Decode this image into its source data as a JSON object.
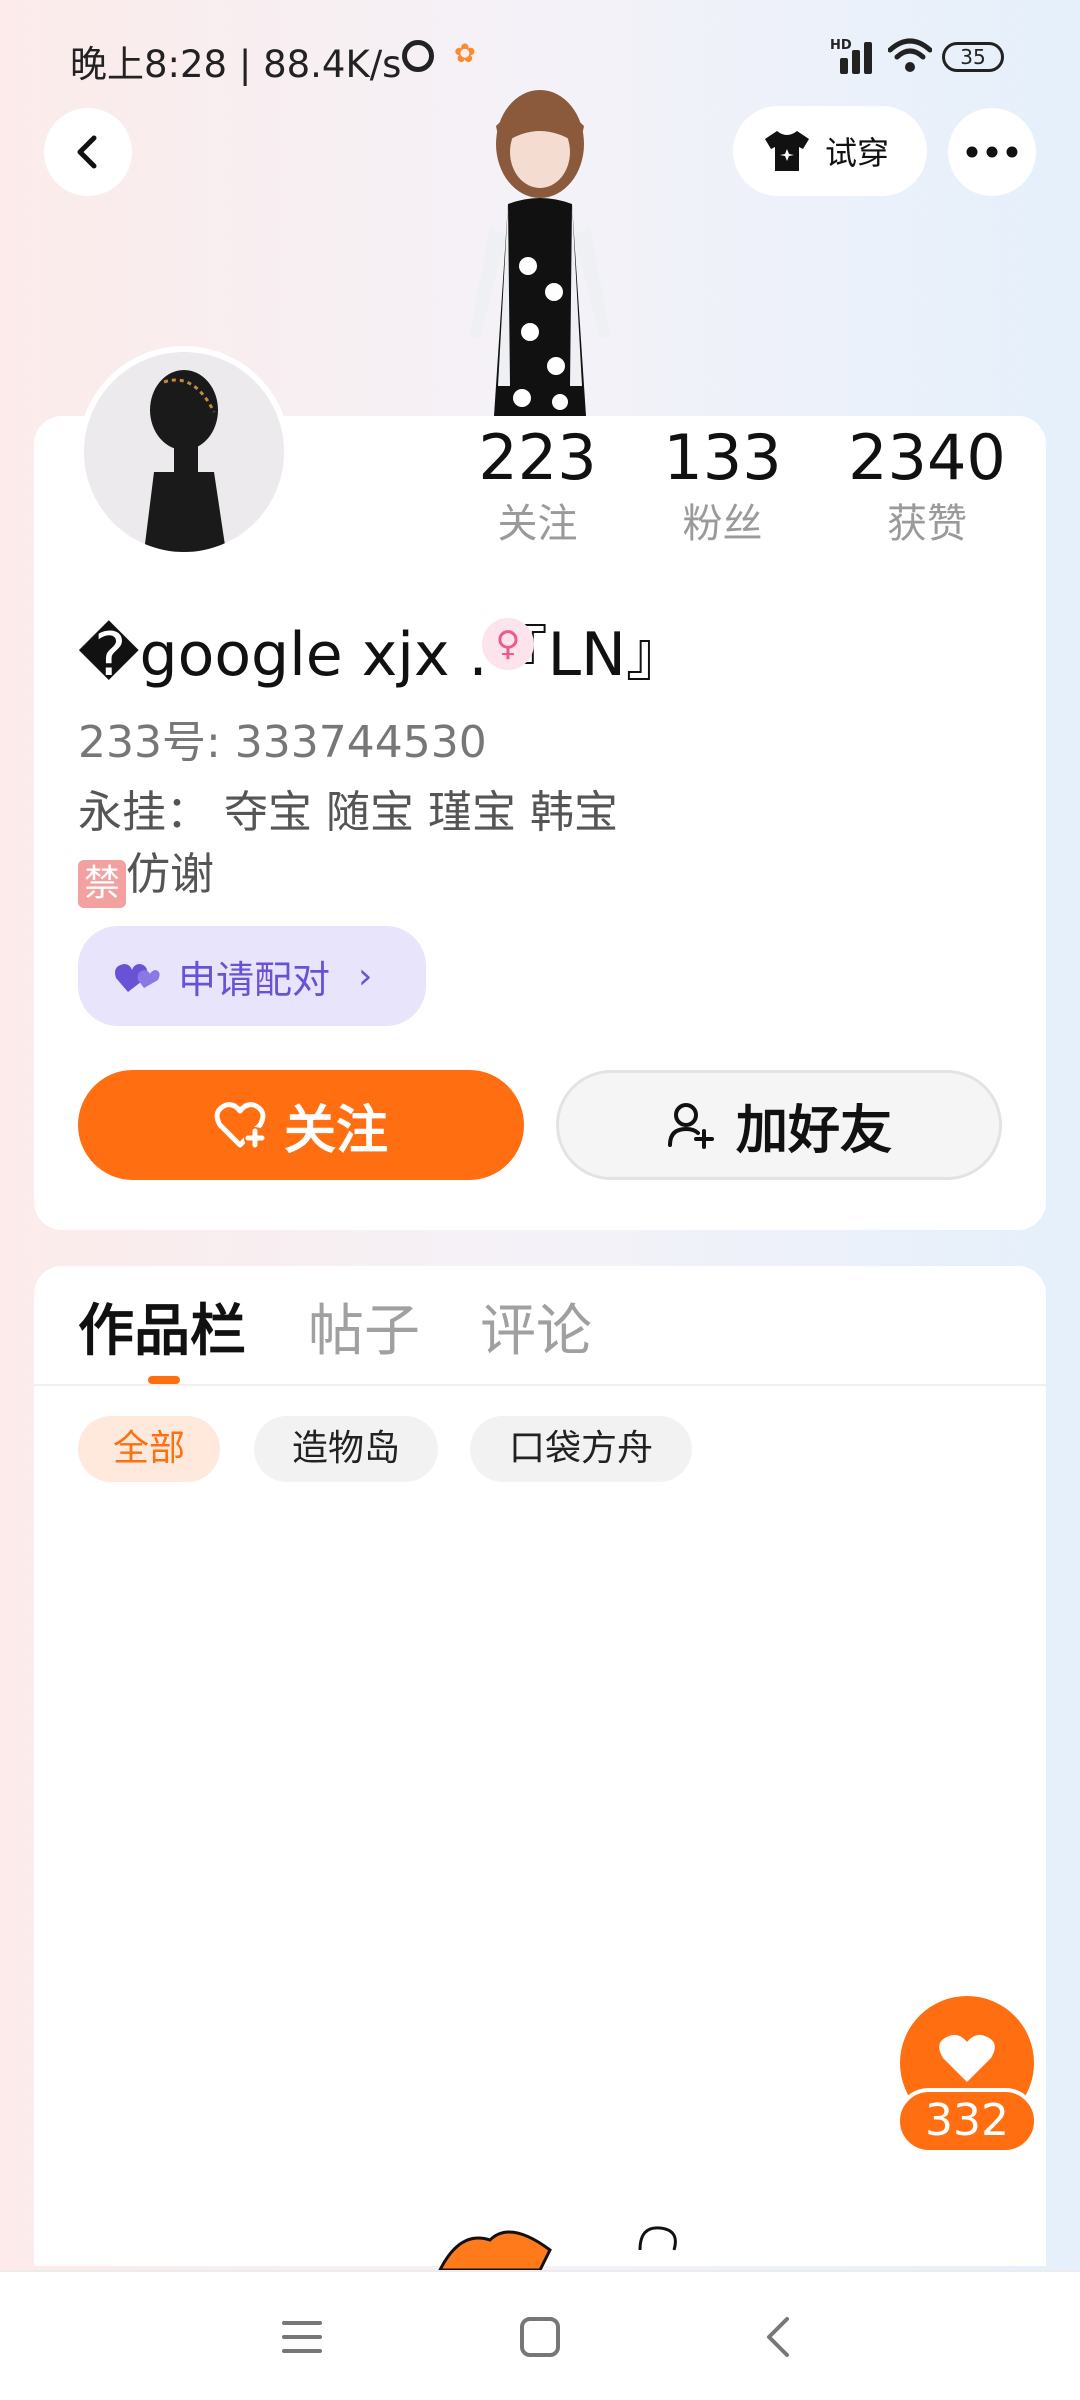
{
  "status_bar": {
    "time_speed": "晚上8:28 | 88.4K/s",
    "battery": "35",
    "signal_label": "HD"
  },
  "header": {
    "tryon_label": "试穿"
  },
  "profile": {
    "stats": {
      "following_count": "223",
      "following_label": "关注",
      "followers_count": "133",
      "followers_label": "粉丝",
      "likes_count": "2340",
      "likes_label": "获赞"
    },
    "username": "�google xjx .『LN』",
    "gender": "♀",
    "user_id": "233号: 333744530",
    "bio_line1": "永挂： 夺宝 随宝 瑾宝 韩宝",
    "bio_ban_icon": "禁",
    "bio_line2": "仿谢",
    "pair_label": "申请配对",
    "follow_label": "关注",
    "add_friend_label": "加好友"
  },
  "works": {
    "tabs": [
      "作品栏",
      "帖子",
      "评论"
    ],
    "active_tab": 0,
    "filters": [
      "全部",
      "造物岛",
      "口袋方舟"
    ],
    "active_filter": 0
  },
  "like_fab": {
    "count": "332"
  },
  "colors": {
    "accent": "#ff6f12",
    "pair_purple": "#6a52d6",
    "pair_bg": "#e8e4fb"
  },
  "icons": {
    "back": "chevron-left-icon",
    "more": "more-horizontal-icon",
    "tryon": "tshirt-icon",
    "pair": "hearts-icon",
    "follow": "heart-plus-icon",
    "add_friend": "user-plus-icon",
    "like": "heart-icon",
    "nav_menu": "menu-icon",
    "nav_home": "square-icon",
    "nav_back": "chevron-left-icon"
  }
}
